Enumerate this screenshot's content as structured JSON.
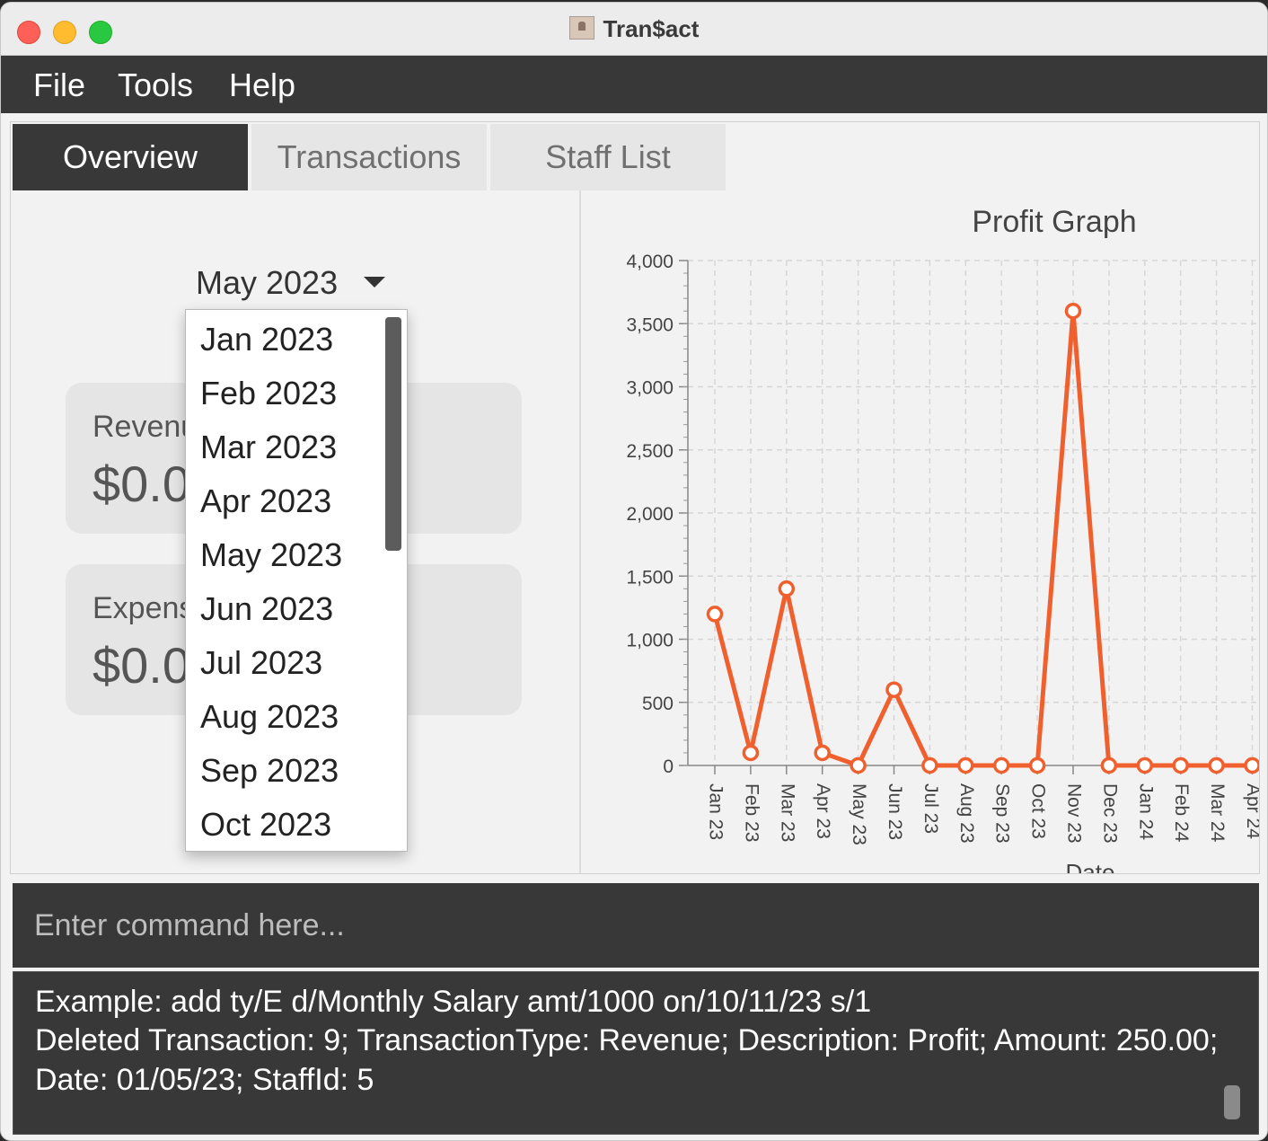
{
  "window": {
    "title": "Tran$act"
  },
  "menu": {
    "items": [
      "File",
      "Tools",
      "Help"
    ]
  },
  "tabs": [
    {
      "label": "Overview",
      "active": true
    },
    {
      "label": "Transactions",
      "active": false
    },
    {
      "label": "Staff List",
      "active": false
    }
  ],
  "overview": {
    "selected_month": "May 2023",
    "dropdown_options": [
      "Jan 2023",
      "Feb 2023",
      "Mar 2023",
      "Apr 2023",
      "May 2023",
      "Jun 2023",
      "Jul 2023",
      "Aug 2023",
      "Sep 2023",
      "Oct 2023"
    ],
    "revenue": {
      "label": "Revenu",
      "value": "$0.0"
    },
    "expense": {
      "label": "Expens",
      "value": "$0.0"
    }
  },
  "chart_data": {
    "type": "line",
    "title": "Profit Graph",
    "xlabel": "Date",
    "ylabel": "",
    "ylim": [
      0,
      4000
    ],
    "yticks": [
      "0",
      "500",
      "1,000",
      "1,500",
      "2,000",
      "2,500",
      "3,000",
      "3,500",
      "4,000"
    ],
    "categories": [
      "Jan 23",
      "Feb 23",
      "Mar 23",
      "Apr 23",
      "May 23",
      "Jun 23",
      "Jul 23",
      "Aug 23",
      "Sep 23",
      "Oct 23",
      "Nov 23",
      "Dec 23",
      "Jan 24",
      "Feb 24",
      "Mar 24",
      "Apr 24"
    ],
    "series": [
      {
        "values": [
          1200,
          100,
          1400,
          100,
          0,
          600,
          0,
          0,
          0,
          0,
          3600,
          0,
          0,
          0,
          0,
          0
        ],
        "color": "#f0602e"
      }
    ],
    "grid": true
  },
  "command": {
    "placeholder": "Enter command here..."
  },
  "result": {
    "lines": [
      "Example: add ty/E d/Monthly Salary amt/1000 on/10/11/23 s/1",
      "Deleted Transaction: 9; TransactionType: Revenue; Description: Profit; Amount: 250.00;",
      "Date: 01/05/23; StaffId: 5"
    ]
  }
}
